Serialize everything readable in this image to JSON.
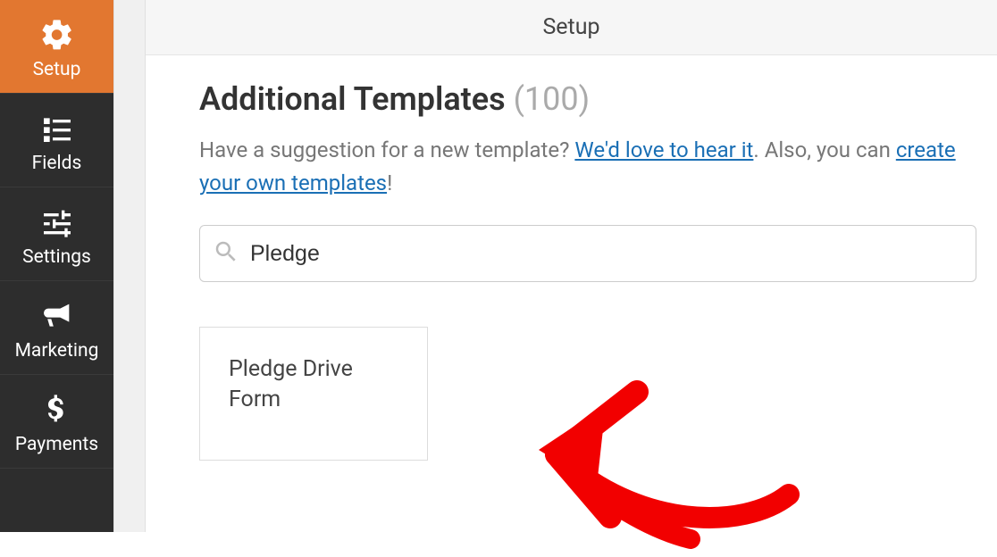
{
  "sidebar": {
    "items": [
      {
        "label": "Setup"
      },
      {
        "label": "Fields"
      },
      {
        "label": "Settings"
      },
      {
        "label": "Marketing"
      },
      {
        "label": "Payments"
      }
    ]
  },
  "header": {
    "title": "Setup"
  },
  "templates": {
    "heading": "Additional Templates",
    "count": "(100)",
    "description_prefix": "Have a suggestion for a new template? ",
    "link1": "We'd love to hear it",
    "description_mid": ". Also, you can ",
    "link2": "create your own templates",
    "description_suffix": "!"
  },
  "search": {
    "value": "Pledge"
  },
  "results": [
    {
      "title": "Pledge Drive Form"
    }
  ]
}
